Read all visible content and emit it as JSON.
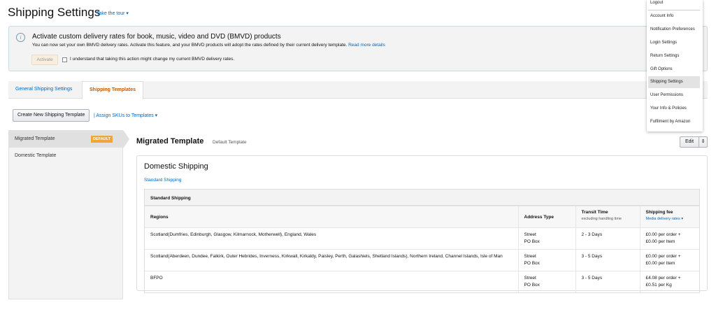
{
  "header": {
    "title": "Shipping Settings",
    "tour": "Take the tour ▾"
  },
  "banner": {
    "heading": "Activate custom delivery rates for book, music, video and DVD (BMVD) products",
    "text": "You can now set your own BMVD delivery rates. Activate this feature, and your BMVD products will adopt the rates defined by their current delivery template.",
    "read_more": "Read more details",
    "activate": "Activate",
    "checkbox_label": "I understand that taking this action might change my current BMVD delivery rates.",
    "icon": "info-icon"
  },
  "tabs": [
    {
      "label": "General Shipping Settings"
    },
    {
      "label": "Shipping Templates",
      "active": true
    }
  ],
  "toolbar": {
    "create": "Create New Shipping Template",
    "assign": "| Assign SKUs to Templates ▾"
  },
  "sidebar": {
    "items": [
      {
        "label": "Migrated Template",
        "badge": "DEFAULT"
      },
      {
        "label": "Domestic Template"
      }
    ]
  },
  "template": {
    "title": "Migrated Template",
    "subtitle": "Default Template",
    "edit": "Edit",
    "edit_menu": "⇕"
  },
  "domestic": {
    "title": "Domestic Shipping",
    "link": "Standard Shipping",
    "table_title": "Standard Shipping",
    "columns": {
      "regions": "Regions",
      "address": "Address Type",
      "transit": "Transit Time",
      "transit_sub": "excluding handling time",
      "fee": "Shipping fee",
      "fee_sub": "Media delivery rates ▾"
    },
    "rows": [
      {
        "region": "Scotland(Dumfries, Edinburgh, Glasgow, Kilmarnock, Motherwell), England, Wales",
        "addr1": "Street",
        "addr2": "PO Box",
        "transit": "2 - 3 Days",
        "fee1": "£0.00 per order +",
        "fee2": "£0.00 per Item"
      },
      {
        "region": "Scotland(Aberdeen, Dundee, Falkirk, Outer Hebrides, Inverness, Kirkwall, Kirkaldy, Paisley, Perth, Galashiels, Shetland Islands), Northern Ireland, Channel Islands, Isle of Man",
        "addr1": "Street",
        "addr2": "PO Box",
        "transit": "3 - 5 Days",
        "fee1": "£0.00 per order +",
        "fee2": "£0.00 per Item"
      },
      {
        "region": "BFPO",
        "addr1": "Street",
        "addr2": "PO Box",
        "transit": "3 - 5 Days",
        "fee1": "£4.08 per order +",
        "fee2": "£0.51 per Kg"
      }
    ]
  },
  "menu": {
    "items": [
      "Logout",
      "Account Info",
      "Notification Preferences",
      "Login Settings",
      "Return Settings",
      "Gift Options",
      "Shipping Settings",
      "User Permissions",
      "Your Info & Policies",
      "Fulfilment by Amazon"
    ],
    "selected": "Shipping Settings"
  }
}
